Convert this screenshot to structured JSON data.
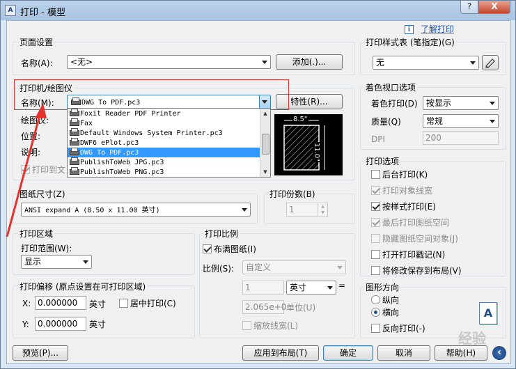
{
  "window": {
    "title": "打印 - 模型",
    "app_icon": "AutoCAD",
    "help_btn": "?",
    "close_btn": "X"
  },
  "top": {
    "info_icon": "i",
    "learn_link": "了解打印"
  },
  "page_setup": {
    "group": "页面设置",
    "name_label": "名称(A):",
    "name_value": "<无>",
    "add_button": "添加(.)..."
  },
  "plotter": {
    "group": "打印机/绘图仪",
    "name_label": "名称(M):",
    "name_value": "DWG To PDF.pc3",
    "properties_button": "特性(R)...",
    "plotter_label": "绘图仪:",
    "location_label": "位置:",
    "desc_label": "说明:",
    "plot_to_file": "打印到文",
    "list": [
      "Foxit Reader PDF Printer",
      "Fax",
      "Default Windows System Printer.pc3",
      "DWF6 ePlot.pc3",
      "DWG To PDF.pc3",
      "PublishToWeb JPG.pc3",
      "PublishToWeb PNG.pc3"
    ],
    "selected_index": 4,
    "preview_width": "8.5\"",
    "preview_height": "11.0\""
  },
  "paper": {
    "group": "图纸尺寸(Z)",
    "value": "ANSI expand A (8.50 x 11.00 英寸)"
  },
  "copies": {
    "group": "打印份数(B)",
    "value": "1"
  },
  "area": {
    "group": "打印区域",
    "range_label": "打印范围(W):",
    "range_value": "显示"
  },
  "offset": {
    "group": "打印偏移 (原点设置在可打印区域)",
    "x_label": "X:",
    "x_value": "0.000000",
    "x_unit": "英寸",
    "center": "居中打印(C)",
    "y_label": "Y:",
    "y_value": "0.000000",
    "y_unit": "英寸"
  },
  "scale": {
    "group": "打印比例",
    "fit": "布满图纸(I)",
    "scale_label": "比例(S):",
    "scale_value": "自定义",
    "v1": "1",
    "unit": "英寸",
    "eq": "=",
    "v2": "2.065e+00",
    "unit2": "单位(U)",
    "lineweight": "缩放线宽(L)"
  },
  "style_table": {
    "group": "打印样式表 (笔指定)(G)",
    "value": "无"
  },
  "shaded": {
    "group": "着色视口选项",
    "shade_label": "着色打印(D)",
    "shade_value": "按显示",
    "quality_label": "质量(Q)",
    "quality_value": "常规",
    "dpi_label": "DPI",
    "dpi_value": "200"
  },
  "options": {
    "group": "打印选项",
    "items": [
      "后台打印(K)",
      "打印对象线宽",
      "按样式打印(E)",
      "最后打印图纸空间",
      "隐藏图纸空间对象(J)",
      "打开打印戳记(N)",
      "将修改保存到布局(V)"
    ]
  },
  "orientation": {
    "group": "图形方向",
    "portrait": "纵向",
    "landscape": "横向",
    "reverse": "反向打印(-)",
    "preview_letter": "A"
  },
  "bottom": {
    "preview": "预览(P)...",
    "apply": "应用到布局(T)",
    "ok": "确定",
    "cancel": "取消",
    "help": "帮助(H)",
    "more": "‹"
  },
  "watermark": "经验",
  "colors": {
    "highlight_box": "#e4332e",
    "selection": "#3399ff"
  }
}
